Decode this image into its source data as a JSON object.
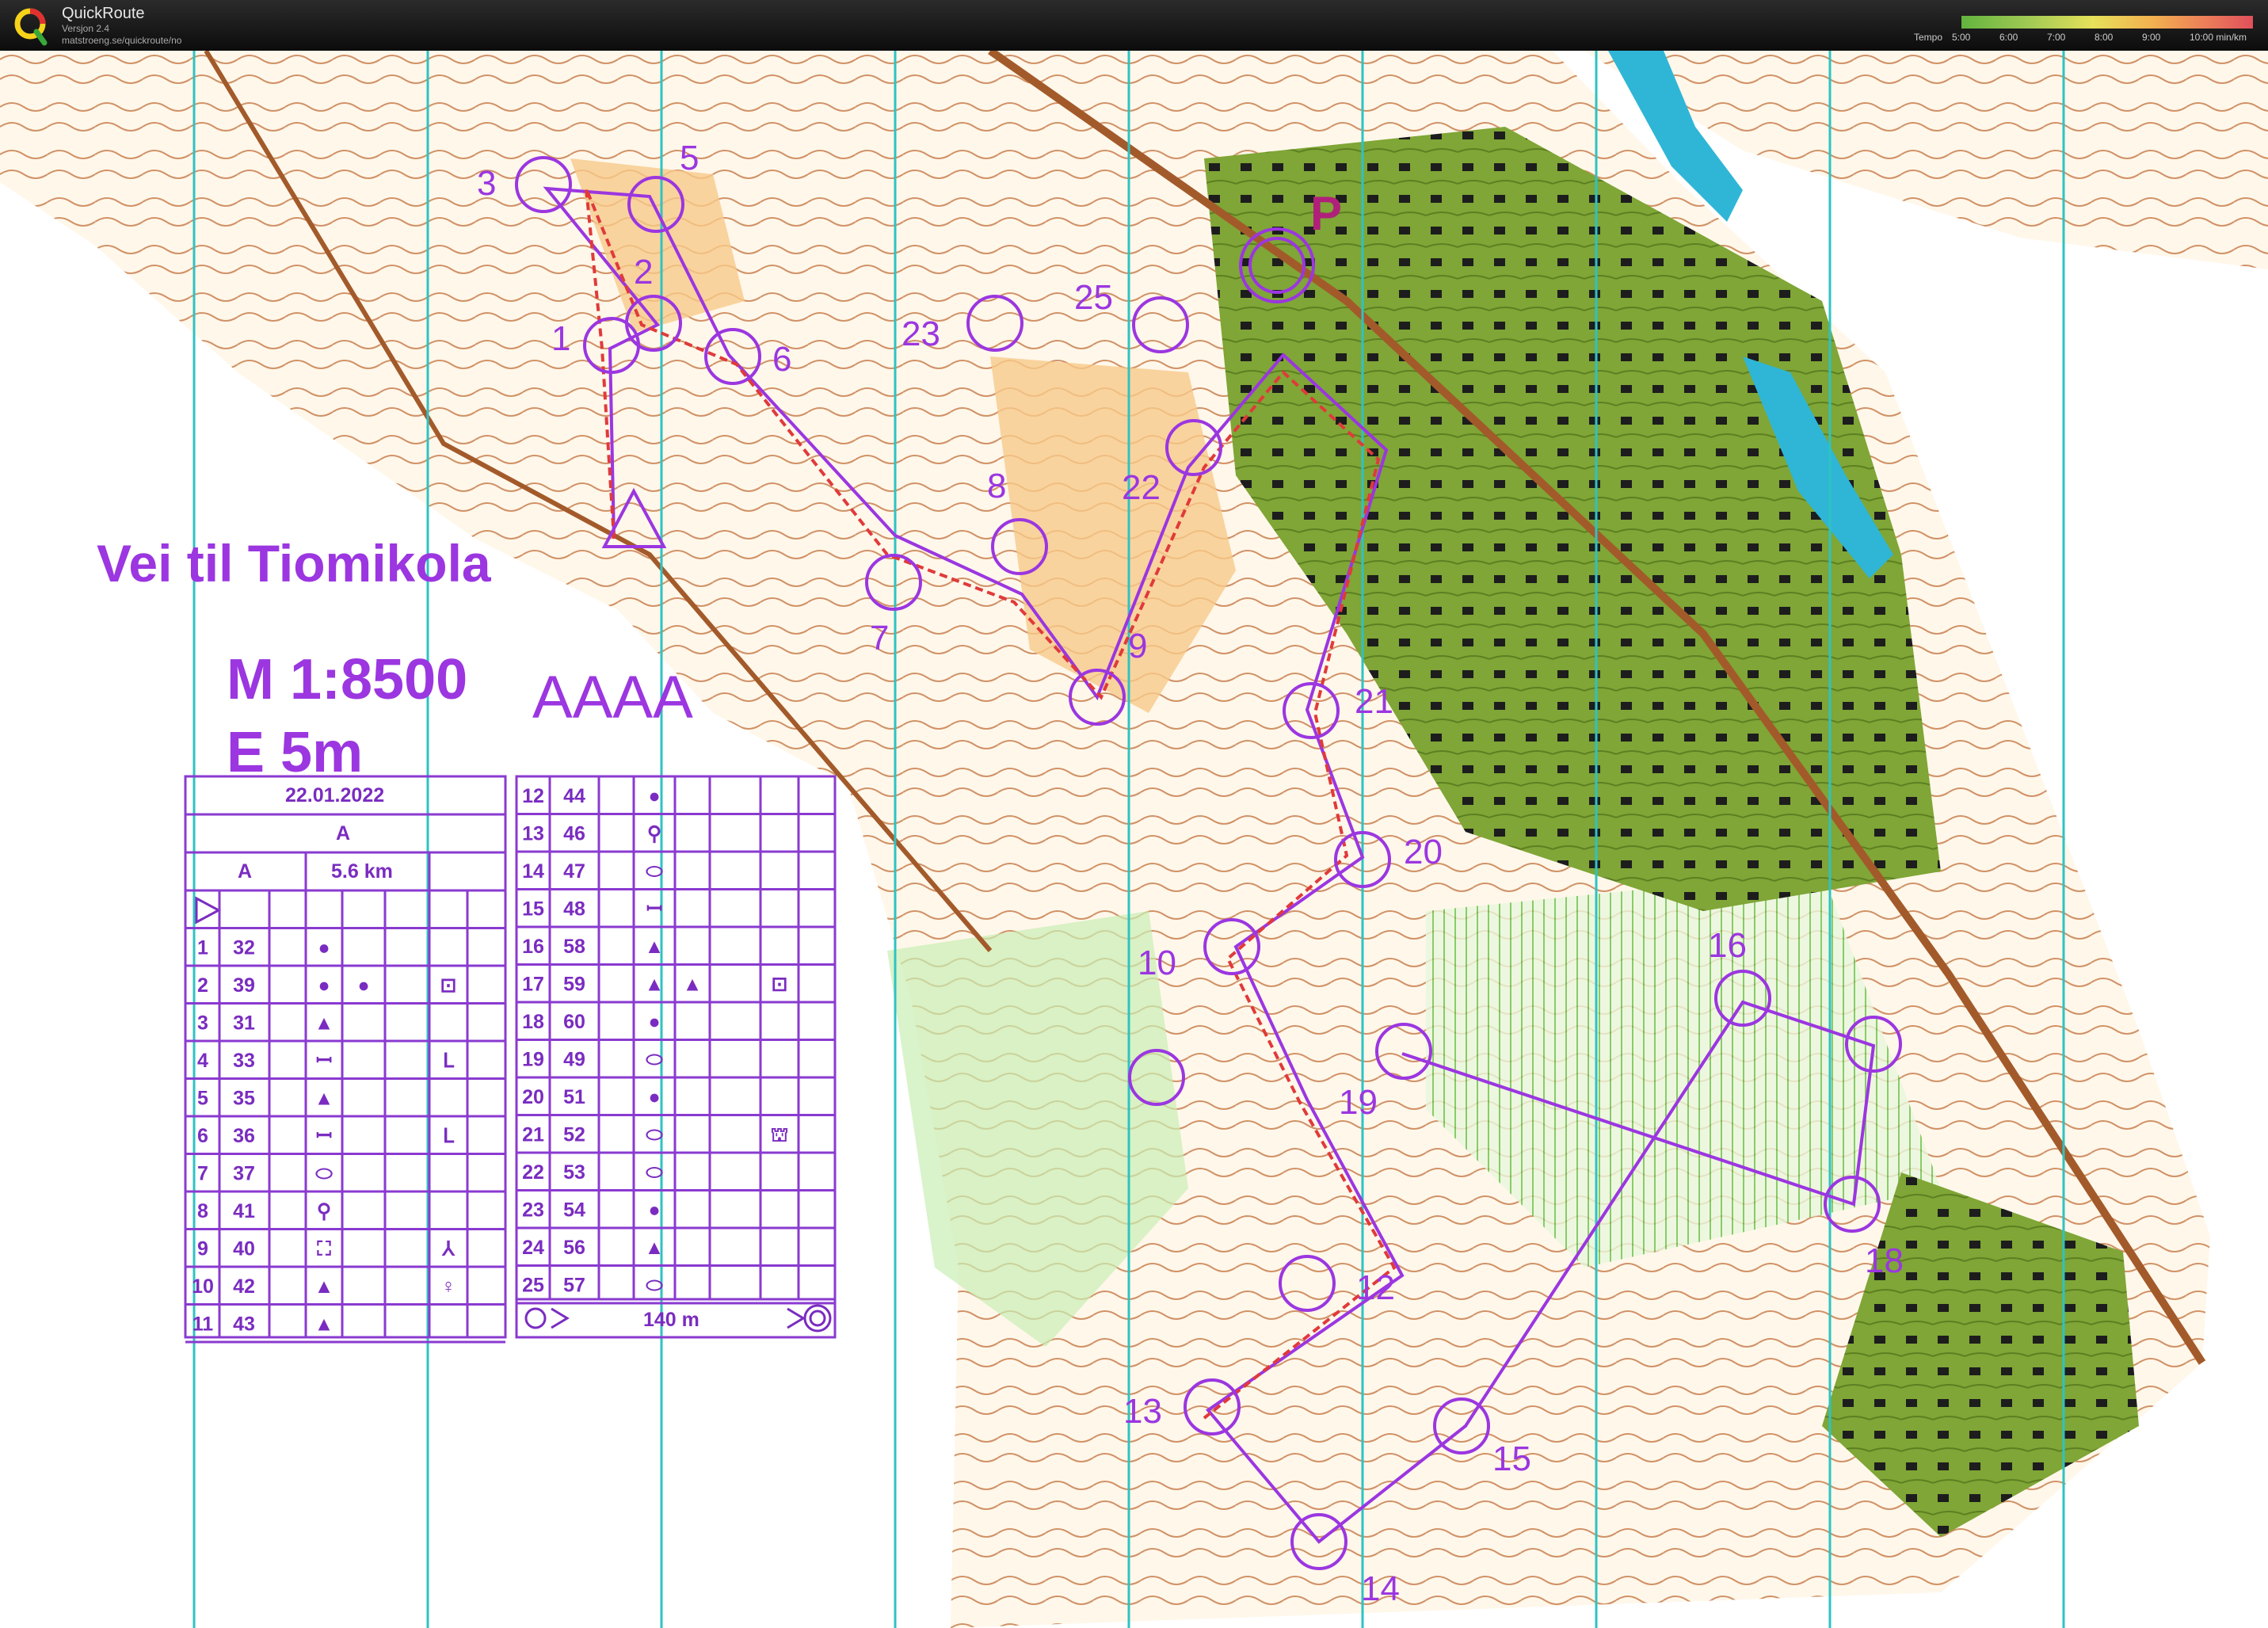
{
  "app": {
    "name": "QuickRoute",
    "version": "Versjon 2.4",
    "url": "matstroeng.se/quickroute/no"
  },
  "tempo_legend": {
    "label": "Tempo",
    "ticks": [
      "5:00",
      "6:00",
      "7:00",
      "8:00",
      "9:00",
      "10:00 min/km"
    ]
  },
  "map": {
    "title": "Vei til Tiomikola",
    "scale": "M 1:8500",
    "equidistance": "E 5m",
    "tag": "AAAA",
    "controls": [
      {
        "n": "1"
      },
      {
        "n": "2"
      },
      {
        "n": "3"
      },
      {
        "n": "5"
      },
      {
        "n": "6"
      },
      {
        "n": "7"
      },
      {
        "n": "8"
      },
      {
        "n": "9"
      },
      {
        "n": "10"
      },
      {
        "n": "12"
      },
      {
        "n": "13"
      },
      {
        "n": "14"
      },
      {
        "n": "15"
      },
      {
        "n": "16"
      },
      {
        "n": "18"
      },
      {
        "n": "19"
      },
      {
        "n": "20"
      },
      {
        "n": "21"
      },
      {
        "n": "22"
      },
      {
        "n": "23"
      },
      {
        "n": "25"
      }
    ],
    "parking_label": "P"
  },
  "description": {
    "date": "22.01.2022",
    "class": "A",
    "course": "A",
    "length": "5.6 km",
    "left_rows": [
      {
        "n": "1",
        "code": "32",
        "feature": "●",
        "extra": "",
        "other": ""
      },
      {
        "n": "2",
        "code": "39",
        "feature": "●",
        "extra": "●",
        "other": "⊡"
      },
      {
        "n": "3",
        "code": "31",
        "feature": "▲",
        "extra": "",
        "other": ""
      },
      {
        "n": "4",
        "code": "33",
        "feature": "ꟷ",
        "extra": "",
        "other": "ᒪ"
      },
      {
        "n": "5",
        "code": "35",
        "feature": "▲",
        "extra": "",
        "other": ""
      },
      {
        "n": "6",
        "code": "36",
        "feature": "ꟷ",
        "extra": "",
        "other": "ᒪ"
      },
      {
        "n": "7",
        "code": "37",
        "feature": "⬭",
        "extra": "",
        "other": ""
      },
      {
        "n": "8",
        "code": "41",
        "feature": "⚲",
        "extra": "",
        "other": ""
      },
      {
        "n": "9",
        "code": "40",
        "feature": "⛶",
        "extra": "",
        "other": "⅄"
      },
      {
        "n": "10",
        "code": "42",
        "feature": "▲",
        "extra": "",
        "other": "♀"
      },
      {
        "n": "11",
        "code": "43",
        "feature": "▲",
        "extra": "",
        "other": ""
      }
    ],
    "right_rows": [
      {
        "n": "12",
        "code": "44",
        "feature": "●",
        "extra": "",
        "other": ""
      },
      {
        "n": "13",
        "code": "46",
        "feature": "⚲",
        "extra": "",
        "other": ""
      },
      {
        "n": "14",
        "code": "47",
        "feature": "⬭",
        "extra": "",
        "other": ""
      },
      {
        "n": "15",
        "code": "48",
        "feature": "ꟷ",
        "extra": "",
        "other": ""
      },
      {
        "n": "16",
        "code": "58",
        "feature": "▲",
        "extra": "",
        "other": ""
      },
      {
        "n": "17",
        "code": "59",
        "feature": "▲",
        "extra": "▲",
        "other": "⊡"
      },
      {
        "n": "18",
        "code": "60",
        "feature": "●",
        "extra": "",
        "other": ""
      },
      {
        "n": "19",
        "code": "49",
        "feature": "⬭",
        "extra": "",
        "other": ""
      },
      {
        "n": "20",
        "code": "51",
        "feature": "●",
        "extra": "",
        "other": ""
      },
      {
        "n": "21",
        "code": "52",
        "feature": "⬭",
        "extra": "",
        "other": "⛫"
      },
      {
        "n": "22",
        "code": "53",
        "feature": "⬭",
        "extra": "",
        "other": ""
      },
      {
        "n": "23",
        "code": "54",
        "feature": "●",
        "extra": "",
        "other": ""
      },
      {
        "n": "24",
        "code": "56",
        "feature": "▲",
        "extra": "",
        "other": ""
      },
      {
        "n": "25",
        "code": "57",
        "feature": "⬭",
        "extra": "",
        "other": ""
      }
    ],
    "finish_distance": "140 m"
  },
  "colors": {
    "course_purple": "#9b36e0",
    "terrain_orange": "#f7c98a",
    "forest_green": "#7fa636",
    "light_green": "#c9eeb3",
    "water_blue": "#2fb6d6",
    "meridian_cyan": "#2ec3c3"
  }
}
